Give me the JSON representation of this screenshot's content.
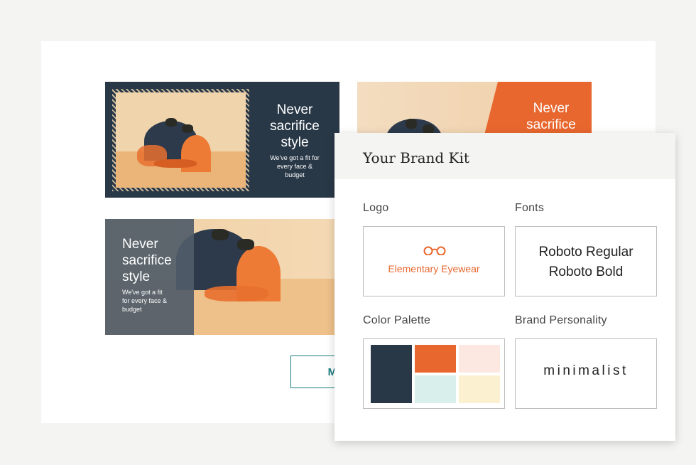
{
  "banners": [
    {
      "headline_lines": [
        "Never",
        "sacrifice",
        "style"
      ],
      "sub_lines": [
        "We've got a fit for",
        "every face &",
        "budget"
      ]
    },
    {
      "headline_lines": [
        "Never",
        "sacrifice"
      ]
    },
    {
      "headline_lines": [
        "Never",
        "sacrifice",
        "style"
      ],
      "sub_lines": [
        "We've got a fit",
        "for every face &",
        "budget"
      ]
    }
  ],
  "more_button": {
    "label": "More"
  },
  "brand_kit": {
    "title": "Your Brand Kit",
    "logo": {
      "label": "Logo",
      "brand_name": "Elementary Eyewear",
      "icon": "glasses-icon"
    },
    "fonts": {
      "label": "Fonts",
      "items": [
        "Roboto Regular",
        "Roboto Bold"
      ]
    },
    "color_palette": {
      "label": "Color Palette",
      "colors": [
        "#293847",
        "#e8672e",
        "#fce8e0",
        "#d9efec",
        "#fbf0cf"
      ]
    },
    "personality": {
      "label": "Brand Personality",
      "value": "minimalist"
    }
  }
}
